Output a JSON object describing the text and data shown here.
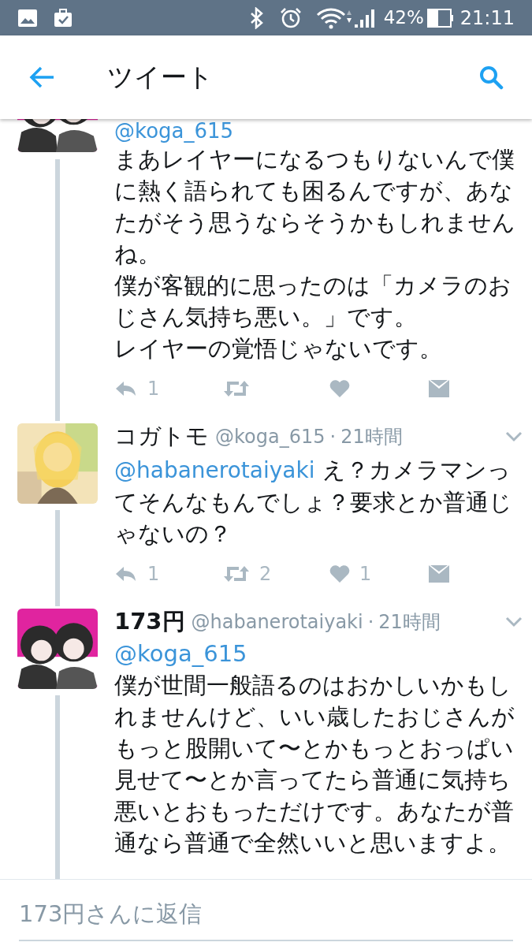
{
  "status_bar": {
    "battery": "42%",
    "time": "21:11"
  },
  "header": {
    "title": "ツイート"
  },
  "tweets": [
    {
      "kind": "cut",
      "handle": "@koga_615",
      "paragraphs": [
        "まあレイヤーになるつもりないんで僕に熱く語られても困るんですが、あなたがそう思うならそうかもしれませんね。",
        "僕が客観的に思ったのは「カメラのおじさん気持ち悪い。」です。",
        "レイヤーの覚悟じゃないです。"
      ],
      "actions": {
        "replies": "1"
      }
    },
    {
      "kind": "full",
      "name": "コガトモ",
      "name_bold": false,
      "handle": "@koga_615",
      "separator": "·",
      "time": "21時間",
      "mention": "@habanerotaiyaki",
      "mention_inline": true,
      "paragraphs": [
        "え？カメラマンってそんなもんでしょ？要求とか普通じゃないの？"
      ],
      "actions": {
        "replies": "1",
        "retweets": "2",
        "likes": "1"
      }
    },
    {
      "kind": "full",
      "name": "173円",
      "name_bold": true,
      "handle": "@habanerotaiyaki",
      "separator": "·",
      "time": "21時間",
      "mention": "@koga_615",
      "mention_inline": false,
      "paragraphs": [
        "僕が世間一般語るのはおかしいかもしれませんけど、いい歳したおじさんがもっと股開いて〜とかもっとおっぱい見せて〜とか言ってたら普通に気持ち悪いとおもっただけです。あなたが普通なら普通で全然いいと思いますよ。"
      ]
    }
  ],
  "reply_field": {
    "placeholder": "173円さんに返信"
  }
}
